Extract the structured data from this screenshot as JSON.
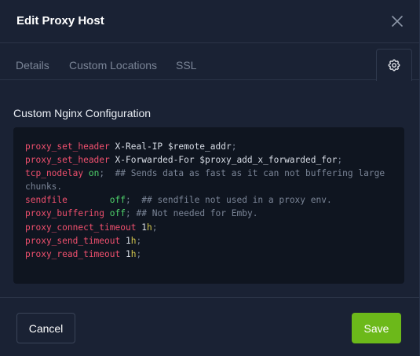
{
  "dialog": {
    "title": "Edit Proxy Host",
    "close_icon": "close-icon"
  },
  "tabs": [
    {
      "label": "Details"
    },
    {
      "label": "Custom Locations"
    },
    {
      "label": "SSL"
    },
    {
      "label": "",
      "icon": "gear-icon",
      "active": true
    }
  ],
  "advanced": {
    "label": "Custom Nginx Configuration",
    "lines": [
      {
        "directive": "proxy_set_header",
        "value": "X-Real-IP $remote_addr",
        "end": ";",
        "comment": ""
      },
      {
        "directive": "proxy_set_header",
        "value": "X-Forwarded-For $proxy_add_x_forwarded_for",
        "end": ";",
        "comment": ""
      },
      {
        "directive": "tcp_nodelay",
        "value": "on",
        "end": ";",
        "comment": "## Sends data as fast as it can not buffering large"
      },
      {
        "directive": "",
        "value": "",
        "end": "",
        "comment": "chunks."
      },
      {
        "directive": "sendfile",
        "value": "off",
        "end": ";",
        "comment": "## sendfile not used in a proxy env."
      },
      {
        "directive": "proxy_buffering",
        "value": "off",
        "end": ";",
        "comment": "## Not needed for Emby."
      },
      {
        "directive": "proxy_connect_timeout",
        "value": "1h",
        "end": ";",
        "comment": ""
      },
      {
        "directive": "proxy_send_timeout",
        "value": "1h",
        "end": ";",
        "comment": ""
      },
      {
        "directive": "proxy_read_timeout",
        "value": "1h",
        "end": ";",
        "comment": ""
      }
    ]
  },
  "footer": {
    "cancel_label": "Cancel",
    "save_label": "Save"
  },
  "colors": {
    "accent_save": "#6cb91a",
    "directive": "#f0506e",
    "on_off": "#4fd36b",
    "duration": "#d5c84e",
    "comment": "#7b8597"
  }
}
